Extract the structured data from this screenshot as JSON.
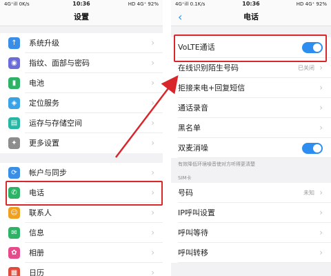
{
  "left": {
    "status": {
      "left": "4G⁺ill 0K/s",
      "time": "10:36",
      "right": "HD 4G⁺ 92%"
    },
    "title": "设置",
    "group1": [
      {
        "label": "系统升级",
        "icon": "system-update-icon",
        "color": "#3a8ee6",
        "glyph": "↑"
      },
      {
        "label": "指纹、面部与密码",
        "icon": "fingerprint-icon",
        "color": "#6c6cd9",
        "glyph": "◉"
      },
      {
        "label": "电池",
        "icon": "battery-icon",
        "color": "#2db266",
        "glyph": "▮"
      },
      {
        "label": "定位服务",
        "icon": "location-icon",
        "color": "#3aa3e6",
        "glyph": "◈"
      },
      {
        "label": "运存与存储空间",
        "icon": "storage-icon",
        "color": "#27b5a4",
        "glyph": "▤"
      },
      {
        "label": "更多设置",
        "icon": "more-settings-icon",
        "color": "#8d8d8d",
        "glyph": "✦"
      }
    ],
    "group2": [
      {
        "label": "帐户与同步",
        "icon": "account-sync-icon",
        "color": "#3a8ee6",
        "glyph": "⟳"
      },
      {
        "label": "电话",
        "icon": "phone-icon",
        "color": "#2db266",
        "glyph": "✆"
      },
      {
        "label": "联系人",
        "icon": "contacts-icon",
        "color": "#f0a020",
        "glyph": "☺"
      },
      {
        "label": "信息",
        "icon": "messages-icon",
        "color": "#2db266",
        "glyph": "✉"
      },
      {
        "label": "相册",
        "icon": "album-icon",
        "color": "#e64a8a",
        "glyph": "✿"
      },
      {
        "label": "日历",
        "icon": "calendar-icon",
        "color": "#e04a3a",
        "glyph": "▦"
      }
    ]
  },
  "right": {
    "status": {
      "left": "4G⁺ill 0.1K/s",
      "time": "10:36",
      "right": "HD 4G⁺ 92%"
    },
    "title": "电话",
    "volte": {
      "label": "VoLTE通话",
      "toggle": "on"
    },
    "rows": [
      {
        "label": "在线识别陌生号码",
        "value": "已关闭"
      },
      {
        "label": "拒接来电+回复短信",
        "value": ""
      },
      {
        "label": "通话录音",
        "value": ""
      },
      {
        "label": "黑名单",
        "value": ""
      }
    ],
    "dual_mic": {
      "label": "双麦消噪",
      "toggle": "on"
    },
    "hint": "有效降低环境噪音使对方听得更清楚",
    "sim_section": "SIM卡",
    "sim_rows": [
      {
        "label": "号码",
        "value": "未知"
      },
      {
        "label": "IP呼叫设置",
        "value": ""
      },
      {
        "label": "呼叫等待",
        "value": ""
      },
      {
        "label": "呼叫转移",
        "value": ""
      }
    ]
  },
  "colors": {
    "accent": "#2d8ef0",
    "annotation": "#d9262b"
  }
}
